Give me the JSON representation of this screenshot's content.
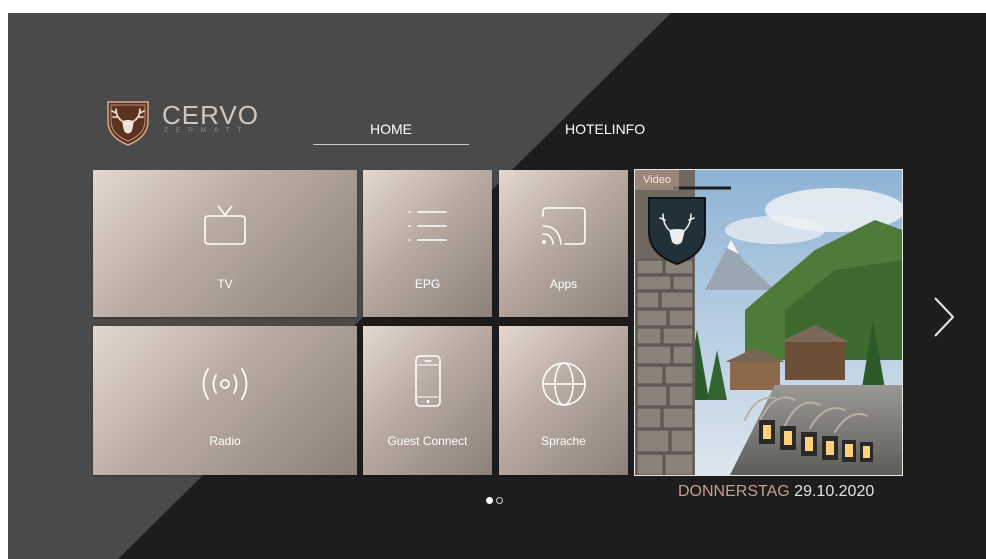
{
  "brand": {
    "name": "CERVO",
    "sub": "ZERMATT"
  },
  "nav": {
    "tabs": [
      {
        "label": "HOME",
        "active": true
      },
      {
        "label": "HOTELINFO",
        "active": false
      }
    ]
  },
  "tiles": [
    {
      "label": "TV",
      "icon": "tv-icon"
    },
    {
      "label": "EPG",
      "icon": "list-icon"
    },
    {
      "label": "Apps",
      "icon": "cast-icon"
    },
    {
      "label": "Radio",
      "icon": "radio-broadcast-icon"
    },
    {
      "label": "Guest Connect",
      "icon": "smartphone-icon"
    },
    {
      "label": "Sprache",
      "icon": "globe-icon"
    }
  ],
  "video": {
    "badge": "Video"
  },
  "pager": {
    "pages": 2,
    "current": 1
  },
  "date": {
    "day": "DONNERSTAG",
    "value": "29.10.2020"
  },
  "colors": {
    "tile_gradient_start": "#e4d7cd",
    "tile_gradient_end": "#8c8079",
    "accent": "#c4a08f",
    "background_dark": "#1d1d1d",
    "background_light": "#4a4a4a"
  }
}
